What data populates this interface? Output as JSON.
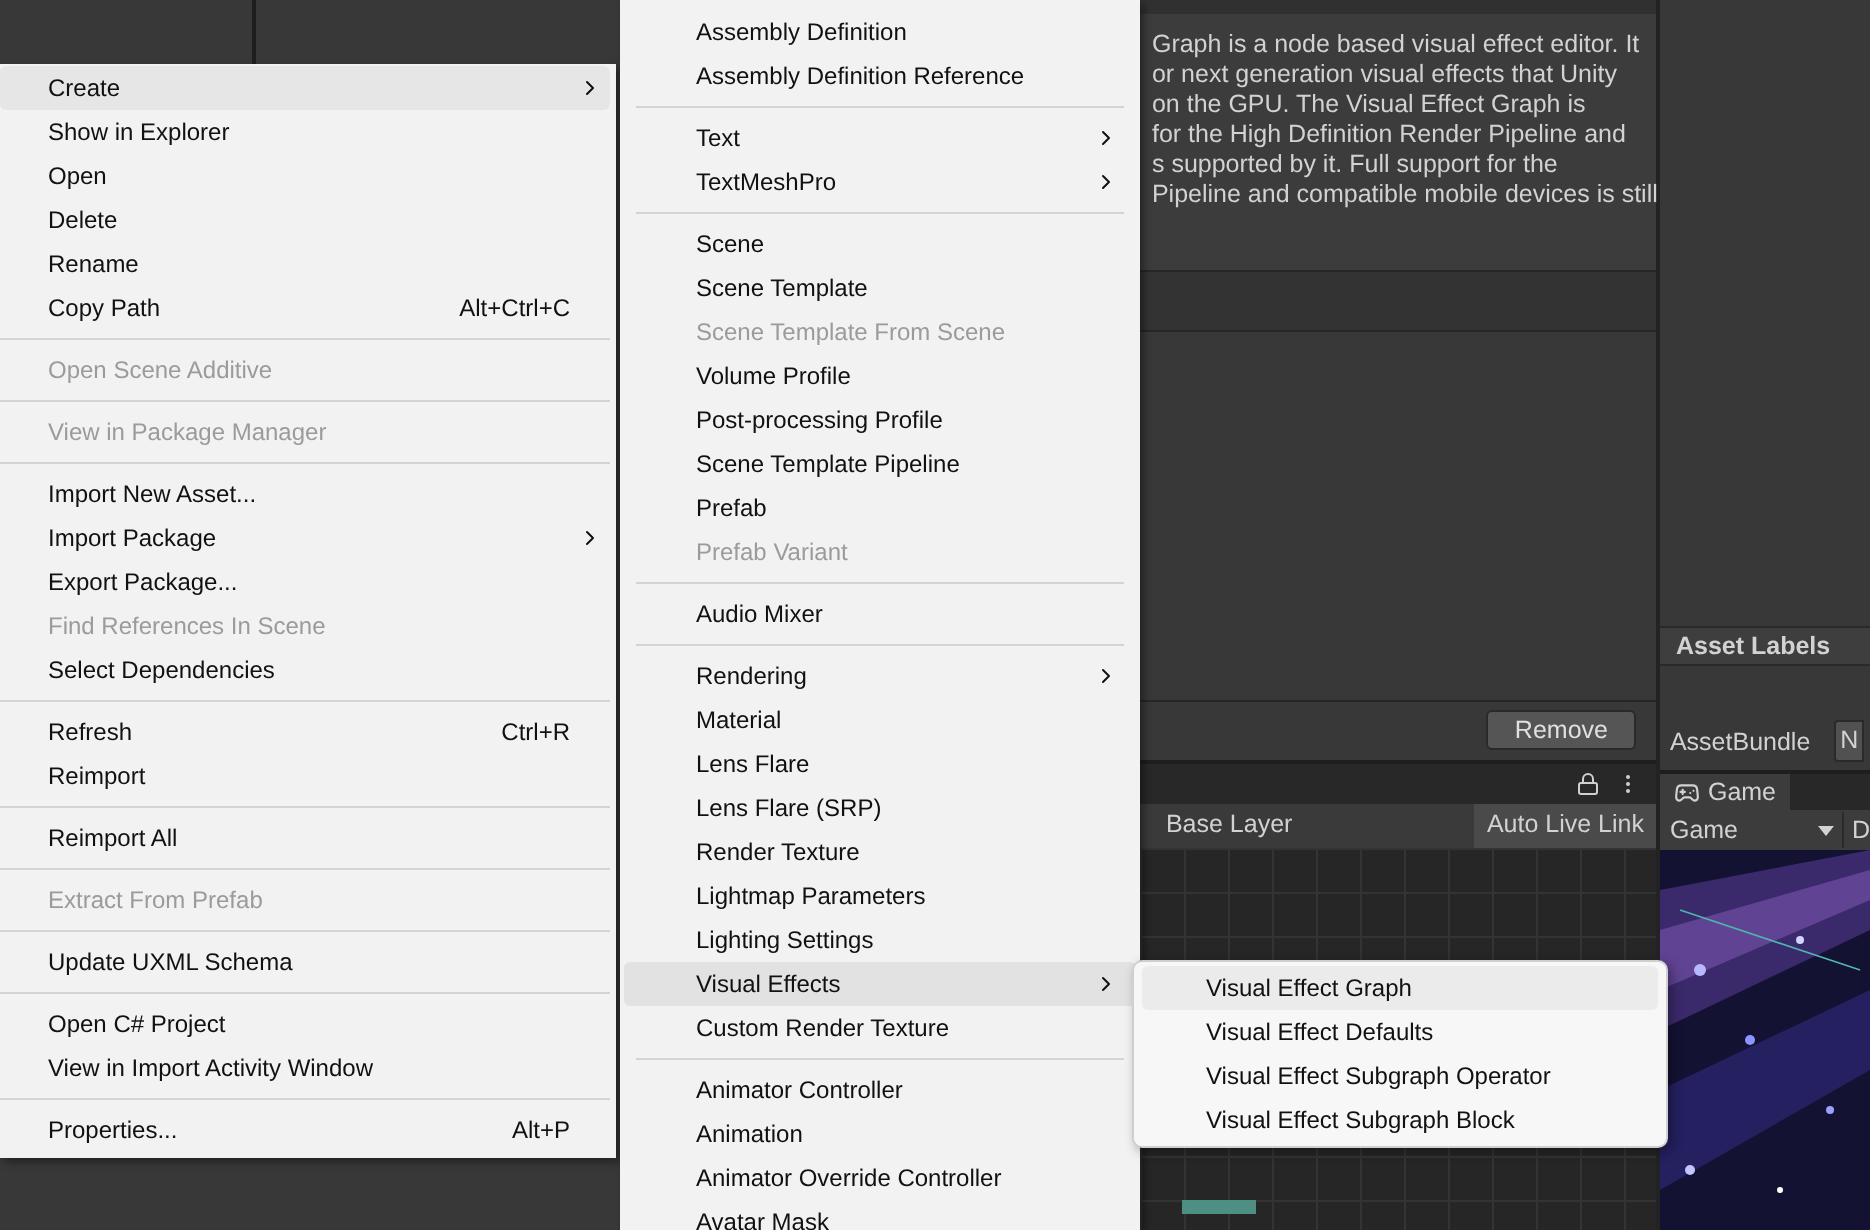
{
  "inspector": {
    "description_lines": [
      "Graph is a node based visual effect editor. It",
      "or next generation visual effects that Unity",
      "on the GPU. The Visual Effect Graph is",
      "for the High Definition Render Pipeline and",
      "s supported by it. Full support for the",
      "Pipeline and compatible mobile devices is still"
    ],
    "remove_button": "Remove",
    "asset_labels": "Asset Labels",
    "asset_bundle_label": "AssetBundle",
    "asset_bundle_value": "N"
  },
  "animator": {
    "breadcrumb": "Base Layer",
    "live_link_button": "Auto Live Link"
  },
  "game_view": {
    "tab": "Game",
    "display_dropdown": "Game",
    "second_dropdown": "D"
  },
  "context_menu": {
    "items": [
      {
        "kind": "item",
        "label": "Create",
        "submenu": true,
        "disabled": false,
        "selected": true
      },
      {
        "kind": "item",
        "label": "Show in Explorer",
        "submenu": false,
        "disabled": false,
        "selected": false
      },
      {
        "kind": "item",
        "label": "Open",
        "submenu": false,
        "disabled": false,
        "selected": false
      },
      {
        "kind": "item",
        "label": "Delete",
        "submenu": false,
        "disabled": false,
        "selected": false
      },
      {
        "kind": "item",
        "label": "Rename",
        "submenu": false,
        "disabled": false,
        "selected": false
      },
      {
        "kind": "item",
        "label": "Copy Path",
        "shortcut": "Alt+Ctrl+C",
        "submenu": false,
        "disabled": false,
        "selected": false
      },
      {
        "kind": "separator"
      },
      {
        "kind": "item",
        "label": "Open Scene Additive",
        "submenu": false,
        "disabled": true,
        "selected": false
      },
      {
        "kind": "separator"
      },
      {
        "kind": "item",
        "label": "View in Package Manager",
        "submenu": false,
        "disabled": true,
        "selected": false
      },
      {
        "kind": "separator"
      },
      {
        "kind": "item",
        "label": "Import New Asset...",
        "submenu": false,
        "disabled": false,
        "selected": false
      },
      {
        "kind": "item",
        "label": "Import Package",
        "submenu": true,
        "disabled": false,
        "selected": false
      },
      {
        "kind": "item",
        "label": "Export Package...",
        "submenu": false,
        "disabled": false,
        "selected": false
      },
      {
        "kind": "item",
        "label": "Find References In Scene",
        "submenu": false,
        "disabled": true,
        "selected": false
      },
      {
        "kind": "item",
        "label": "Select Dependencies",
        "submenu": false,
        "disabled": false,
        "selected": false
      },
      {
        "kind": "separator"
      },
      {
        "kind": "item",
        "label": "Refresh",
        "shortcut": "Ctrl+R",
        "submenu": false,
        "disabled": false,
        "selected": false
      },
      {
        "kind": "item",
        "label": "Reimport",
        "submenu": false,
        "disabled": false,
        "selected": false
      },
      {
        "kind": "separator"
      },
      {
        "kind": "item",
        "label": "Reimport All",
        "submenu": false,
        "disabled": false,
        "selected": false
      },
      {
        "kind": "separator"
      },
      {
        "kind": "item",
        "label": "Extract From Prefab",
        "submenu": false,
        "disabled": true,
        "selected": false
      },
      {
        "kind": "separator"
      },
      {
        "kind": "item",
        "label": "Update UXML Schema",
        "submenu": false,
        "disabled": false,
        "selected": false
      },
      {
        "kind": "separator"
      },
      {
        "kind": "item",
        "label": "Open C# Project",
        "submenu": false,
        "disabled": false,
        "selected": false
      },
      {
        "kind": "item",
        "label": "View in Import Activity Window",
        "submenu": false,
        "disabled": false,
        "selected": false
      },
      {
        "kind": "separator"
      },
      {
        "kind": "item",
        "label": "Properties...",
        "shortcut": "Alt+P",
        "submenu": false,
        "disabled": false,
        "selected": false
      }
    ]
  },
  "create_submenu": {
    "items": [
      {
        "kind": "item",
        "label": "Assembly Definition",
        "submenu": false,
        "disabled": false,
        "selected": false
      },
      {
        "kind": "item",
        "label": "Assembly Definition Reference",
        "submenu": false,
        "disabled": false,
        "selected": false
      },
      {
        "kind": "separator"
      },
      {
        "kind": "item",
        "label": "Text",
        "submenu": true,
        "disabled": false,
        "selected": false
      },
      {
        "kind": "item",
        "label": "TextMeshPro",
        "submenu": true,
        "disabled": false,
        "selected": false
      },
      {
        "kind": "separator"
      },
      {
        "kind": "item",
        "label": "Scene",
        "submenu": false,
        "disabled": false,
        "selected": false
      },
      {
        "kind": "item",
        "label": "Scene Template",
        "submenu": false,
        "disabled": false,
        "selected": false
      },
      {
        "kind": "item",
        "label": "Scene Template From Scene",
        "submenu": false,
        "disabled": true,
        "selected": false
      },
      {
        "kind": "item",
        "label": "Volume Profile",
        "submenu": false,
        "disabled": false,
        "selected": false
      },
      {
        "kind": "item",
        "label": "Post-processing Profile",
        "submenu": false,
        "disabled": false,
        "selected": false
      },
      {
        "kind": "item",
        "label": "Scene Template Pipeline",
        "submenu": false,
        "disabled": false,
        "selected": false
      },
      {
        "kind": "item",
        "label": "Prefab",
        "submenu": false,
        "disabled": false,
        "selected": false
      },
      {
        "kind": "item",
        "label": "Prefab Variant",
        "submenu": false,
        "disabled": true,
        "selected": false
      },
      {
        "kind": "separator"
      },
      {
        "kind": "item",
        "label": "Audio Mixer",
        "submenu": false,
        "disabled": false,
        "selected": false
      },
      {
        "kind": "separator"
      },
      {
        "kind": "item",
        "label": "Rendering",
        "submenu": true,
        "disabled": false,
        "selected": false
      },
      {
        "kind": "item",
        "label": "Material",
        "submenu": false,
        "disabled": false,
        "selected": false
      },
      {
        "kind": "item",
        "label": "Lens Flare",
        "submenu": false,
        "disabled": false,
        "selected": false
      },
      {
        "kind": "item",
        "label": "Lens Flare (SRP)",
        "submenu": false,
        "disabled": false,
        "selected": false
      },
      {
        "kind": "item",
        "label": "Render Texture",
        "submenu": false,
        "disabled": false,
        "selected": false
      },
      {
        "kind": "item",
        "label": "Lightmap Parameters",
        "submenu": false,
        "disabled": false,
        "selected": false
      },
      {
        "kind": "item",
        "label": "Lighting Settings",
        "submenu": false,
        "disabled": false,
        "selected": false
      },
      {
        "kind": "item",
        "label": "Visual Effects",
        "submenu": true,
        "disabled": false,
        "selected": true
      },
      {
        "kind": "item",
        "label": "Custom Render Texture",
        "submenu": false,
        "disabled": false,
        "selected": false
      },
      {
        "kind": "separator"
      },
      {
        "kind": "item",
        "label": "Animator Controller",
        "submenu": false,
        "disabled": false,
        "selected": false
      },
      {
        "kind": "item",
        "label": "Animation",
        "submenu": false,
        "disabled": false,
        "selected": false
      },
      {
        "kind": "item",
        "label": "Animator Override Controller",
        "submenu": false,
        "disabled": false,
        "selected": false
      },
      {
        "kind": "item",
        "label": "Avatar Mask",
        "submenu": false,
        "disabled": false,
        "selected": false
      }
    ]
  },
  "visual_effects_submenu": {
    "items": [
      {
        "kind": "item",
        "label": "Visual Effect Graph",
        "submenu": false,
        "disabled": false,
        "selected": true
      },
      {
        "kind": "item",
        "label": "Visual Effect Defaults",
        "submenu": false,
        "disabled": false,
        "selected": false
      },
      {
        "kind": "item",
        "label": "Visual Effect Subgraph Operator",
        "submenu": false,
        "disabled": false,
        "selected": false
      },
      {
        "kind": "item",
        "label": "Visual Effect Subgraph Block",
        "submenu": false,
        "disabled": false,
        "selected": false
      }
    ]
  }
}
